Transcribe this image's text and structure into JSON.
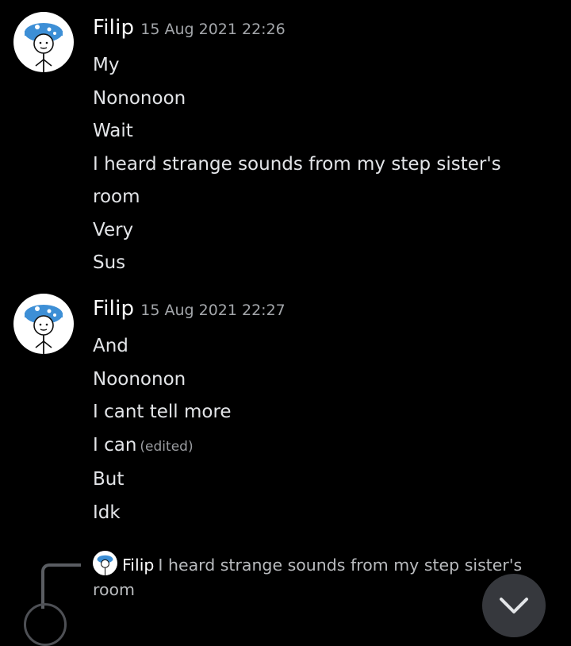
{
  "colors": {
    "background": "#000000",
    "username": "#ffffff",
    "message_text": "#e3e5e8",
    "timestamp": "#a3a6aa",
    "avatar_hat": "#3d8fd6"
  },
  "messages": [
    {
      "author": "Filip",
      "timestamp": "15 Aug 2021 22:26",
      "avatar_icon": "stick-figure-mushroom-hat-icon",
      "lines": [
        {
          "text": "My"
        },
        {
          "text": "Nononoon"
        },
        {
          "text": "Wait"
        },
        {
          "text": "I heard strange sounds from my step sister's"
        },
        {
          "text": "room"
        },
        {
          "text": "Very"
        },
        {
          "text": "Sus"
        }
      ]
    },
    {
      "author": "Filip",
      "timestamp": "15 Aug 2021 22:27",
      "avatar_icon": "stick-figure-mushroom-hat-icon",
      "lines": [
        {
          "text": "And"
        },
        {
          "text": "Noononon"
        },
        {
          "text": "I cant tell more"
        },
        {
          "text": "I can",
          "edited": "(edited)"
        },
        {
          "text": "But"
        },
        {
          "text": "Idk"
        }
      ]
    }
  ],
  "reply": {
    "author": "Filip",
    "text": "I heard strange sounds from my step sister's room"
  },
  "scroll_button": {
    "icon": "chevron-down-icon"
  }
}
